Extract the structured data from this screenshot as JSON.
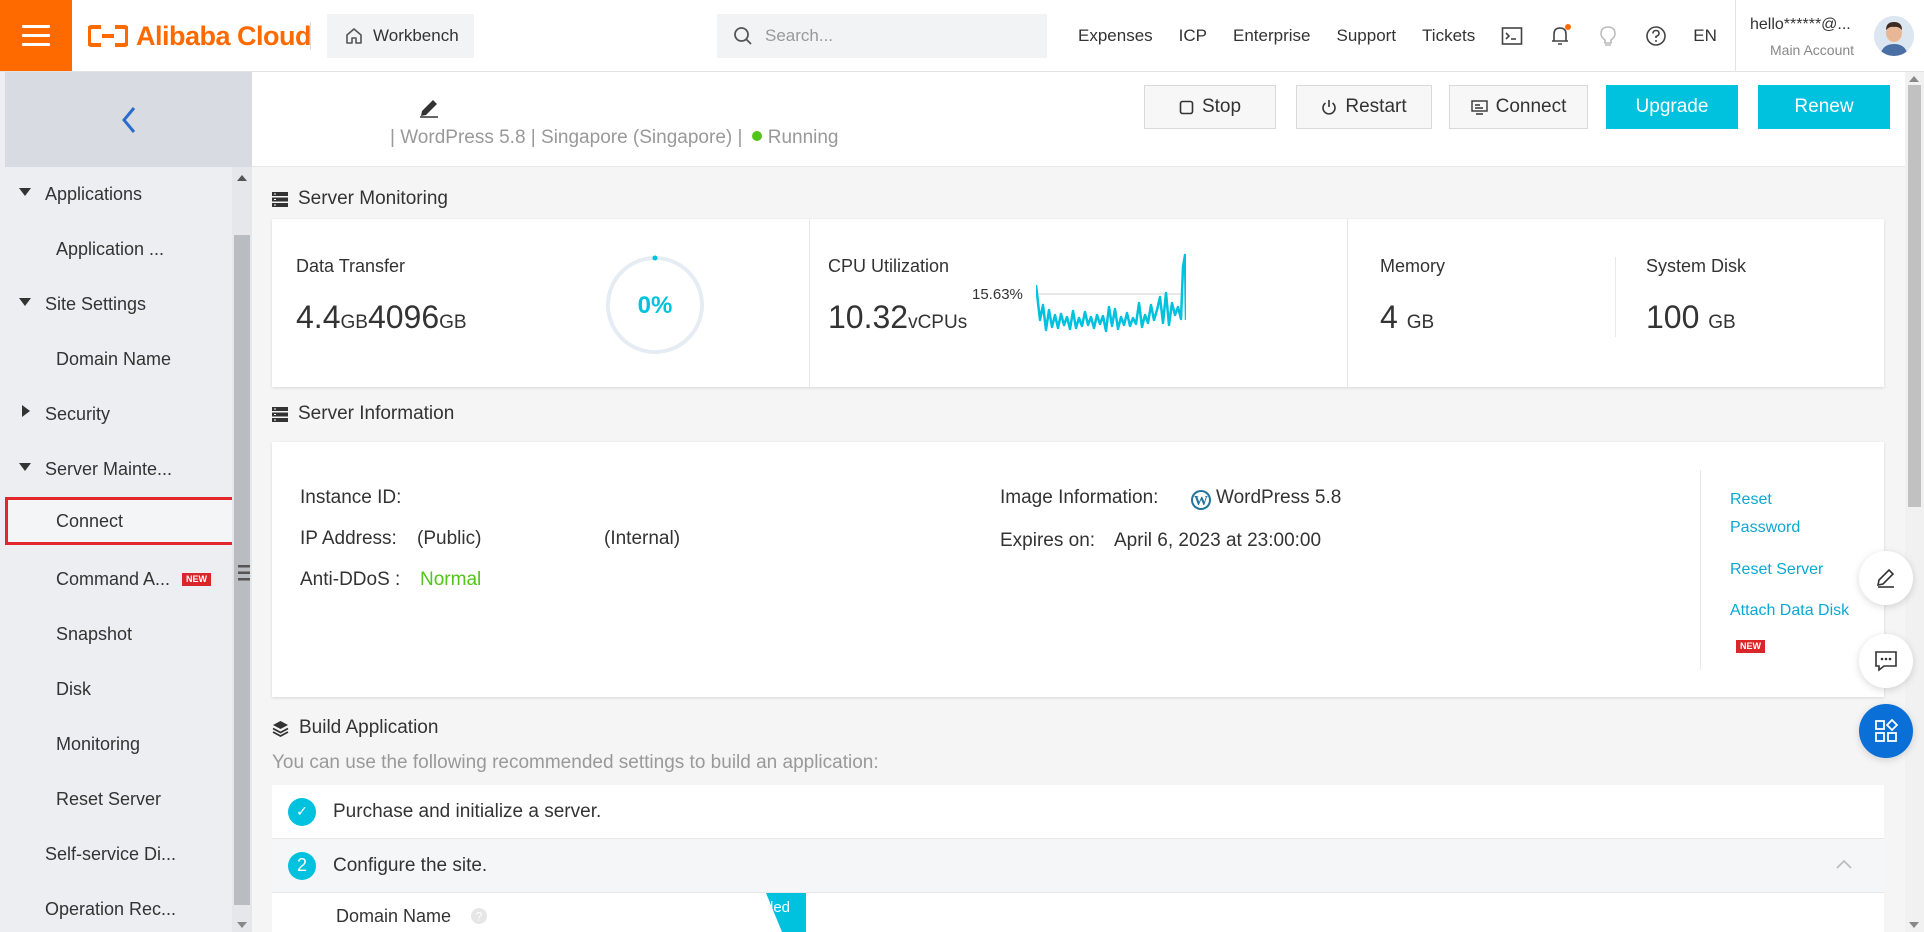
{
  "topbar": {
    "brand": "Alibaba Cloud",
    "workbench": "Workbench",
    "search_placeholder": "Search...",
    "nav": [
      "Expenses",
      "ICP",
      "Enterprise",
      "Support",
      "Tickets"
    ],
    "language": "EN",
    "account_name": "hello******@...",
    "account_type": "Main Account",
    "brand_color": "#ff6a00"
  },
  "sidebar": {
    "items": [
      {
        "label": "Applications",
        "level": "group",
        "state": "expanded"
      },
      {
        "label": "Application ...",
        "level": "child"
      },
      {
        "label": "Site Settings",
        "level": "group",
        "state": "expanded"
      },
      {
        "label": "Domain Name",
        "level": "child"
      },
      {
        "label": "Security",
        "level": "group",
        "state": "collapsed"
      },
      {
        "label": "Server Mainte...",
        "level": "group",
        "state": "expanded"
      },
      {
        "label": "Connect",
        "level": "child",
        "selected": true
      },
      {
        "label": "Command A...",
        "level": "child",
        "badge": "NEW"
      },
      {
        "label": "Snapshot",
        "level": "child"
      },
      {
        "label": "Disk",
        "level": "child"
      },
      {
        "label": "Monitoring",
        "level": "child"
      },
      {
        "label": "Reset Server",
        "level": "child"
      },
      {
        "label": "Self-service Di...",
        "level": "group"
      },
      {
        "label": "Operation Rec...",
        "level": "group"
      }
    ]
  },
  "header": {
    "image": "WordPress 5.8",
    "region": "Singapore (Singapore)",
    "status": "Running",
    "status_color": "#52c41a",
    "buttons": {
      "stop": "Stop",
      "restart": "Restart",
      "connect": "Connect",
      "upgrade": "Upgrade",
      "renew": "Renew"
    },
    "accent_color": "#00c1de"
  },
  "monitoring": {
    "title": "Server Monitoring",
    "data_transfer": {
      "label": "Data Transfer",
      "used": "4.4",
      "used_unit": "GB",
      "total": "4096",
      "total_unit": "GB",
      "percent_label": "0%",
      "percent": 0
    },
    "cpu": {
      "label": "CPU Utilization",
      "value": "10.32",
      "unit": "vCPUs",
      "peak_label": "15.63%"
    },
    "memory": {
      "label": "Memory",
      "value": "4",
      "unit": "GB"
    },
    "disk": {
      "label": "System Disk",
      "value": "100",
      "unit": "GB"
    }
  },
  "server_info": {
    "title": "Server Information",
    "instance_id_label": "Instance ID:",
    "ip_label": "IP Address:",
    "ip_public": "(Public)",
    "ip_internal": "(Internal)",
    "anti_ddos_label": "Anti-DDoS :",
    "anti_ddos_value": "Normal",
    "image_label": "Image Information:",
    "image_value": "WordPress 5.8",
    "expires_label": "Expires on:",
    "expires_value": "April 6, 2023 at 23:00:00",
    "actions": {
      "reset_password_1": "Reset",
      "reset_password_2": "Password",
      "reset_server": "Reset Server",
      "attach_disk": "Attach Data Disk",
      "attach_badge": "NEW"
    }
  },
  "build": {
    "title": "Build Application",
    "description": "You can use the following recommended settings to build an application:",
    "steps": [
      {
        "marker": "✓",
        "text": "Purchase and initialize a server."
      },
      {
        "marker": "2",
        "text": "Configure the site."
      }
    ],
    "sub_label": "Domain Name",
    "ribbon": "led"
  },
  "float": [
    "edit-icon",
    "chat-icon",
    "apps-icon"
  ]
}
